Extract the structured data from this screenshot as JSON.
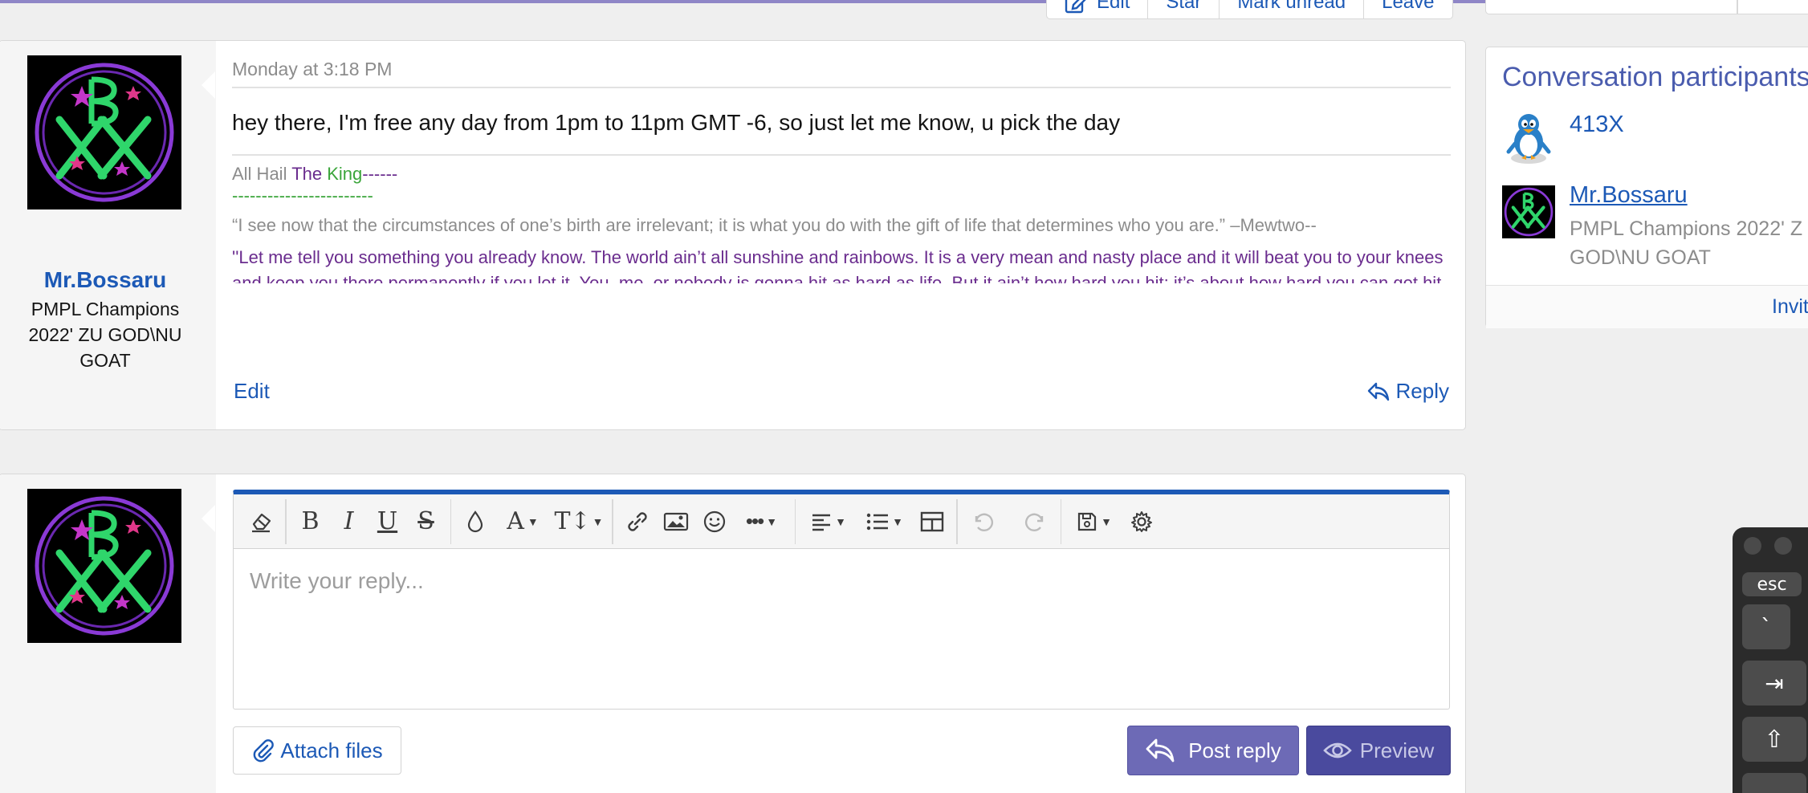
{
  "top_actions": [
    "Edit",
    "Star",
    "Mark unread",
    "Leave"
  ],
  "message1": {
    "username": "Mr.Bossaru",
    "user_title": "PMPL Champions 2022' ZU GOD\\NU GOAT",
    "date": "Monday at 3:18 PM",
    "body": "hey there, I'm free any day from 1pm to 11pm GMT -6, so just let me know, u pick the day",
    "signature": {
      "line1_a": "All Hail ",
      "line1_b": "The ",
      "line1_c": "King",
      "line1_d": "------",
      "line2": "------------------------",
      "quote1": "“I see now that the circumstances of one’s birth are irrelevant; it is what you do with the gift of life that determines who you are.” –Mewtwo--",
      "quote2": "''Let me tell you something you already know. The world ain’t all sunshine and rainbows. It is a very mean and nasty place and it will beat you to your knees and keep you there permanently if you let it. You, me, or nobody is gonna hit as hard as life. But it ain’t how hard you hit; it’s about how hard you can get hit, and keep moving forward. How much you can take, and keep moving forward. That’s how winning is done. Now, if you know what you’re worth, then go out and get what you’re worth. But you gotta be willing to take the hit, and not pointing fingers"
    },
    "edit_label": "Edit",
    "reply_label": "Reply"
  },
  "reply_editor": {
    "placeholder": "Write your reply...",
    "toolbar_icons": [
      "eraser-icon",
      "bold-icon",
      "italic-icon",
      "underline-icon",
      "strikethrough-icon",
      "color-drop-icon",
      "font-family-icon",
      "font-size-icon",
      "link-icon",
      "image-icon",
      "smiley-icon",
      "more-icon",
      "align-icon",
      "list-icon",
      "table-icon",
      "undo-icon",
      "redo-icon",
      "save-draft-icon",
      "settings-icon"
    ],
    "attach_label": "Attach files",
    "post_label": "Post reply",
    "preview_label": "Preview"
  },
  "sidebar": {
    "title": "Conversation participants",
    "participants": [
      {
        "name": "413X",
        "title": ""
      },
      {
        "name": "Mr.Bossaru",
        "title_line1": "PMPL Champions 2022' Z",
        "title_line2": "GOD\\NU GOAT"
      }
    ],
    "footer_label": "Invit"
  },
  "keyboard": {
    "esc": "esc",
    "backtick": "`",
    "tab": "⇥",
    "shift": "⇧"
  },
  "colors": {
    "link": "#1c59b6",
    "sig_purple": "#6a2c8e",
    "sig_green": "#3aa53a",
    "post_button": "#6d6ab6",
    "preview_button": "#4a4a9e",
    "editor_accent": "#1c59b6"
  }
}
